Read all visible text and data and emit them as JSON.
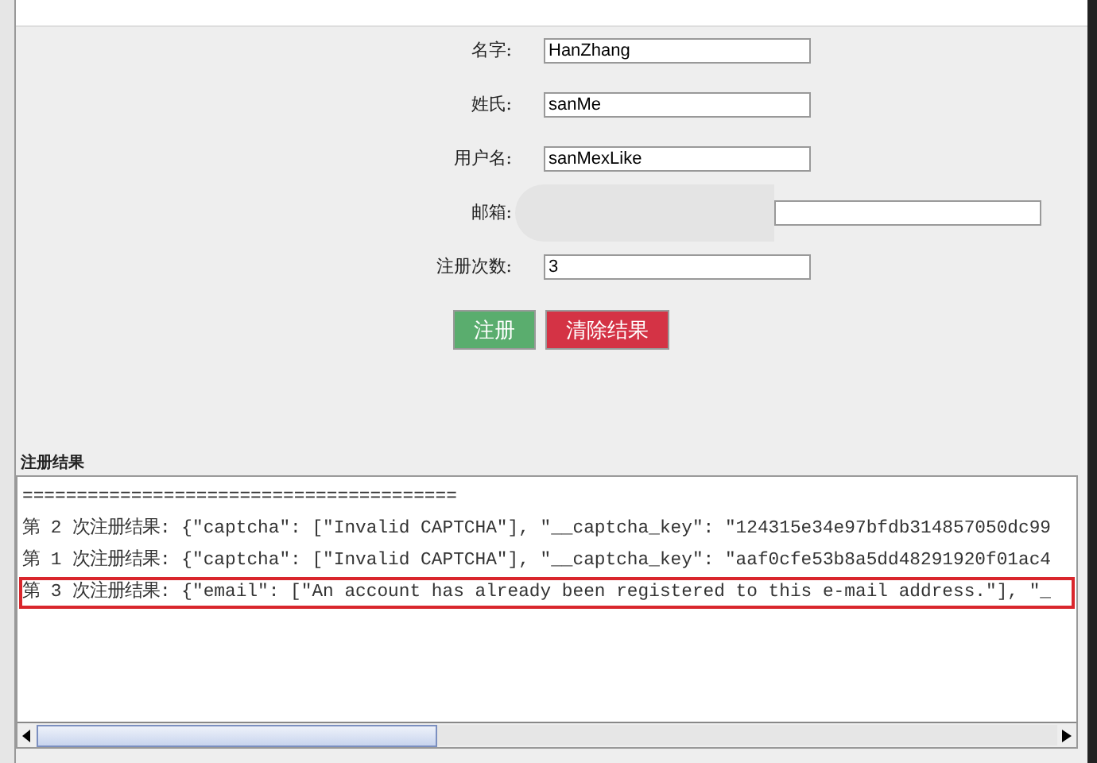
{
  "form": {
    "fields": [
      {
        "label": "名字:",
        "value": "HanZhang"
      },
      {
        "label": "姓氏:",
        "value": "sanMe"
      },
      {
        "label": "用户名:",
        "value": "sanMexLike"
      },
      {
        "label": "邮箱:",
        "redacted": true
      },
      {
        "label": "注册次数:",
        "value": "3"
      }
    ],
    "buttons": [
      {
        "label": "注册",
        "kind": "primary"
      },
      {
        "label": "清除结果",
        "kind": "danger"
      }
    ]
  },
  "results": {
    "title": "注册结果",
    "lines": [
      {
        "text": "========================================",
        "highlighted": false
      },
      {
        "text": "第 2 次注册结果: {\"captcha\": [\"Invalid CAPTCHA\"], \"__captcha_key\": \"124315e34e97bfdb314857050dc99",
        "highlighted": false
      },
      {
        "text": "第 1 次注册结果: {\"captcha\": [\"Invalid CAPTCHA\"], \"__captcha_key\": \"aaf0cfe53b8a5dd48291920f01ac4",
        "highlighted": false
      },
      {
        "text": "第 3 次注册结果: {\"email\": [\"An account has already been registered to this e-mail address.\"], \"_",
        "highlighted": true
      }
    ]
  }
}
